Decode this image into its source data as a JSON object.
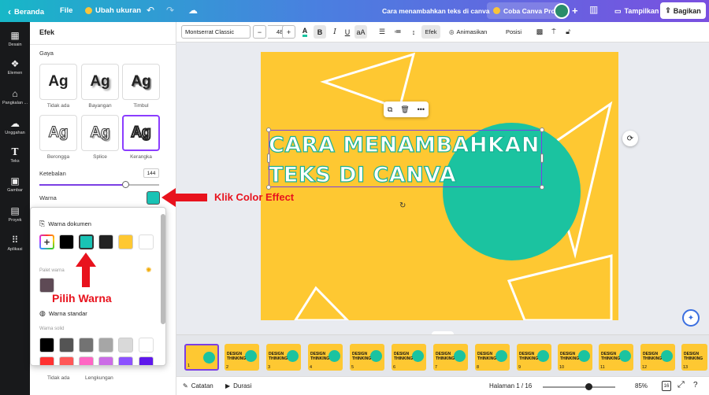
{
  "topbar": {
    "home_label": "Beranda",
    "file_label": "File",
    "resize_label": "Ubah ukuran",
    "doc_title": "Cara menambahkan teks di canva",
    "pro_label": "Coba Canva Pro",
    "present_label": "Tampilkan",
    "share_label": "Bagikan"
  },
  "leftnav": {
    "items": [
      "Desain",
      "Elemen",
      "Pangkalan ...",
      "Unggahan",
      "Teks",
      "Gambar",
      "Proyek",
      "Aplikasi"
    ]
  },
  "panel": {
    "title": "Efek",
    "style_section": "Gaya",
    "styles": [
      {
        "label": "Tidak ada",
        "glyph": "Ag"
      },
      {
        "label": "Bayangan",
        "glyph": "Ag"
      },
      {
        "label": "Timbul",
        "glyph": "Ag"
      },
      {
        "label": "Berongga",
        "glyph": "Ag"
      },
      {
        "label": "Splice",
        "glyph": "Ag"
      },
      {
        "label": "Kerangka",
        "glyph": "Ag"
      }
    ],
    "thickness_label": "Ketebalan",
    "thickness_value": "144",
    "thickness_fraction": 0.71,
    "color_label": "Warna",
    "color_value": "#19c3b5"
  },
  "color_popup": {
    "doc_colors_label": "Warna dokumen",
    "doc_colors": [
      "#000000",
      "#19c3b5",
      "#222222",
      "#fec832",
      "#ffffff"
    ],
    "palette_label": "Palet warna",
    "palette_colors": [
      "#5e4a55"
    ],
    "standard_label": "Warna standar",
    "solid_label": "Warna solid",
    "solid_row1": [
      "#000000",
      "#545454",
      "#737373",
      "#a6a6a6",
      "#d9d9d9",
      "#ffffff"
    ],
    "solid_row2": [
      "#ff3131",
      "#ff5757",
      "#ff66c4",
      "#cb6ce6",
      "#8c52ff",
      "#5e17eb"
    ],
    "under_caps": [
      "Tidak ada",
      "Lengkungan"
    ]
  },
  "toolbar": {
    "font": "Montserrat Classic",
    "size_minus": "−",
    "size": "48",
    "size_plus": "+",
    "bold": "B",
    "italic": "I",
    "case": "aA",
    "effects": "Efek",
    "animate": "Animasikan",
    "position": "Posisi"
  },
  "canvas": {
    "headline_line1": "CARA MENAMBAHKAN",
    "headline_line2": "TEKS DI CANVA",
    "page_color": "#fec832",
    "circle_color": "#1bc3a0"
  },
  "annotations": {
    "color_effect": "Klik Color Effect",
    "pick_color": "Pilih Warna"
  },
  "filmstrip": {
    "thumbs": [
      {
        "num": "1",
        "text": ""
      },
      {
        "num": "2",
        "text": "DESIGN THINKING"
      },
      {
        "num": "3",
        "text": "DESIGN THINKING"
      },
      {
        "num": "4",
        "text": "DESIGN THINKING"
      },
      {
        "num": "5",
        "text": "DESIGN THINKING"
      },
      {
        "num": "6",
        "text": "DESIGN THINKING"
      },
      {
        "num": "7",
        "text": "DESIGN THINKING"
      },
      {
        "num": "8",
        "text": "DESIGN THINKING"
      },
      {
        "num": "9",
        "text": "DESIGN THINKING"
      },
      {
        "num": "10",
        "text": "DESIGN THINKING"
      },
      {
        "num": "11",
        "text": "DESIGN THINKING"
      },
      {
        "num": "12",
        "text": "DESIGN THINKING"
      },
      {
        "num": "13",
        "text": "DESIGN THINKING"
      }
    ]
  },
  "statusbar": {
    "notes": "Catatan",
    "duration": "Durasi",
    "page_indicator": "Halaman 1 / 16",
    "zoom": "85%",
    "zoom_fraction": 0.6,
    "pages_badge": "16"
  }
}
